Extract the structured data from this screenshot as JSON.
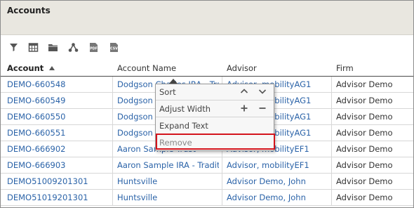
{
  "page": {
    "title": "Accounts"
  },
  "toolbar": {
    "icons": [
      "filter-icon",
      "table-icon",
      "folder-icon",
      "hierarchy-icon",
      "pdf-icon",
      "csv-icon"
    ],
    "pdf_label": "PDF",
    "csv_label": "CSV"
  },
  "columns": {
    "account": "Account",
    "account_name": "Account Name",
    "advisor": "Advisor",
    "firm": "Firm"
  },
  "rows": [
    {
      "account": "DEMO-660548",
      "account_name": "Dodgson Charles IRA - Traditional",
      "advisor": "Advisor, mobilityAG1",
      "firm": "Advisor Demo"
    },
    {
      "account": "DEMO-660549",
      "account_name": "Dodgson Charles",
      "advisor": "Advisor, mobilityAG1",
      "firm": "Advisor Demo"
    },
    {
      "account": "DEMO-660550",
      "account_name": "Dodgson Charles",
      "advisor": "Advisor, mobilityAG1",
      "firm": "Advisor Demo"
    },
    {
      "account": "DEMO-660551",
      "account_name": "Dodgson Charles",
      "advisor": "Advisor, mobilityAG1",
      "firm": "Advisor Demo"
    },
    {
      "account": "DEMO-666902",
      "account_name": "Aaron Sample Trust",
      "advisor": "Advisor, mobilityEF1",
      "firm": "Advisor Demo"
    },
    {
      "account": "DEMO-666903",
      "account_name": "Aaron Sample IRA - Traditional",
      "advisor": "Advisor, mobilityEF1",
      "firm": "Advisor Demo"
    },
    {
      "account": "DEMO51009201301",
      "account_name": "Huntsville",
      "advisor": "Advisor Demo, John",
      "firm": "Advisor Demo"
    },
    {
      "account": "DEMO51019201301",
      "account_name": "Huntsville",
      "advisor": "Advisor Demo, John",
      "firm": "Advisor Demo"
    }
  ],
  "context_menu": {
    "sort": "Sort",
    "adjust_width": "Adjust Width",
    "expand_text": "Expand Text",
    "remove": "Remove"
  },
  "colors": {
    "link": "#2b63a8",
    "header_bg": "#e9e7e0",
    "highlight": "#d3141c"
  }
}
